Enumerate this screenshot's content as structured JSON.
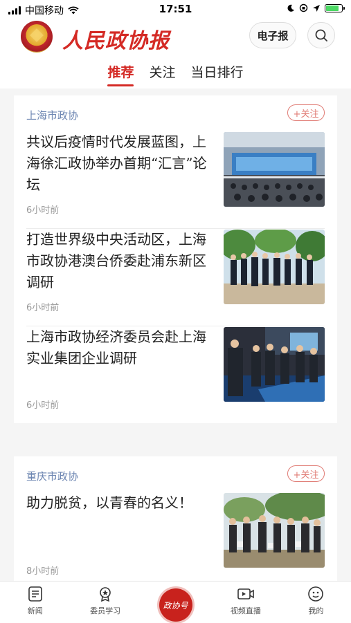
{
  "status_bar": {
    "carrier": "中国移动",
    "time": "17:51"
  },
  "header": {
    "logo_text": "人民政协报",
    "epaper_label": "电子报"
  },
  "tabs": [
    {
      "label": "推荐",
      "active": true
    },
    {
      "label": "关注",
      "active": false
    },
    {
      "label": "当日排行",
      "active": false
    }
  ],
  "feed": [
    {
      "source": "上海市政协",
      "follow_label": "+关注",
      "articles": [
        {
          "title": "共议后疫情时代发展蓝图，上海徐汇政协举办首期“汇言”论坛",
          "time": "6小时前",
          "thumb": "conference-photo"
        },
        {
          "title": "打造世界级中央活动区，上海市政协港澳台侨委赴浦东新区调研",
          "time": "6小时前",
          "thumb": "outdoor-group-photo"
        },
        {
          "title": "上海市政协经济委员会赴上海实业集团企业调研",
          "time": "6小时前",
          "thumb": "exhibition-photo"
        }
      ]
    },
    {
      "source": "重庆市政协",
      "follow_label": "+关注",
      "articles": [
        {
          "title": "助力脱贫，以青春的名义！",
          "time": "8小时前",
          "thumb": "rural-group-photo"
        }
      ]
    }
  ],
  "bottom_nav": [
    {
      "label": "新闻",
      "icon": "news-icon"
    },
    {
      "label": "委员学习",
      "icon": "medal-icon"
    },
    {
      "label": "政协号",
      "icon": "center-logo"
    },
    {
      "label": "视频直播",
      "icon": "video-icon"
    },
    {
      "label": "我的",
      "icon": "profile-icon"
    }
  ],
  "colors": {
    "brand_red": "#d42a25",
    "source_blue": "#6d86b2",
    "follow_pink": "#e07b74"
  }
}
